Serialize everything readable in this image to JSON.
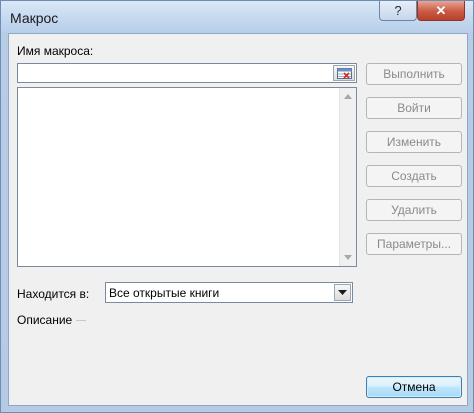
{
  "window": {
    "title": "Макрос",
    "help_label": "?",
    "close_label": "✕"
  },
  "form": {
    "name_label": "Имя макроса:",
    "name_value": "",
    "location_label": "Находится в:",
    "location_value": "Все открытые книги",
    "description_label": "Описание"
  },
  "buttons": {
    "run": "Выполнить",
    "step_into": "Войти",
    "edit": "Изменить",
    "create": "Создать",
    "delete": "Удалить",
    "options": "Параметры...",
    "cancel": "Отмена"
  },
  "icons": {
    "ref": "range-select-icon",
    "scroll_up": "scroll-up-icon",
    "scroll_down": "scroll-down-icon",
    "dropdown": "chevron-down-icon"
  },
  "colors": {
    "disabled_text": "#8a8a8a",
    "close_button": "#c95a43"
  }
}
